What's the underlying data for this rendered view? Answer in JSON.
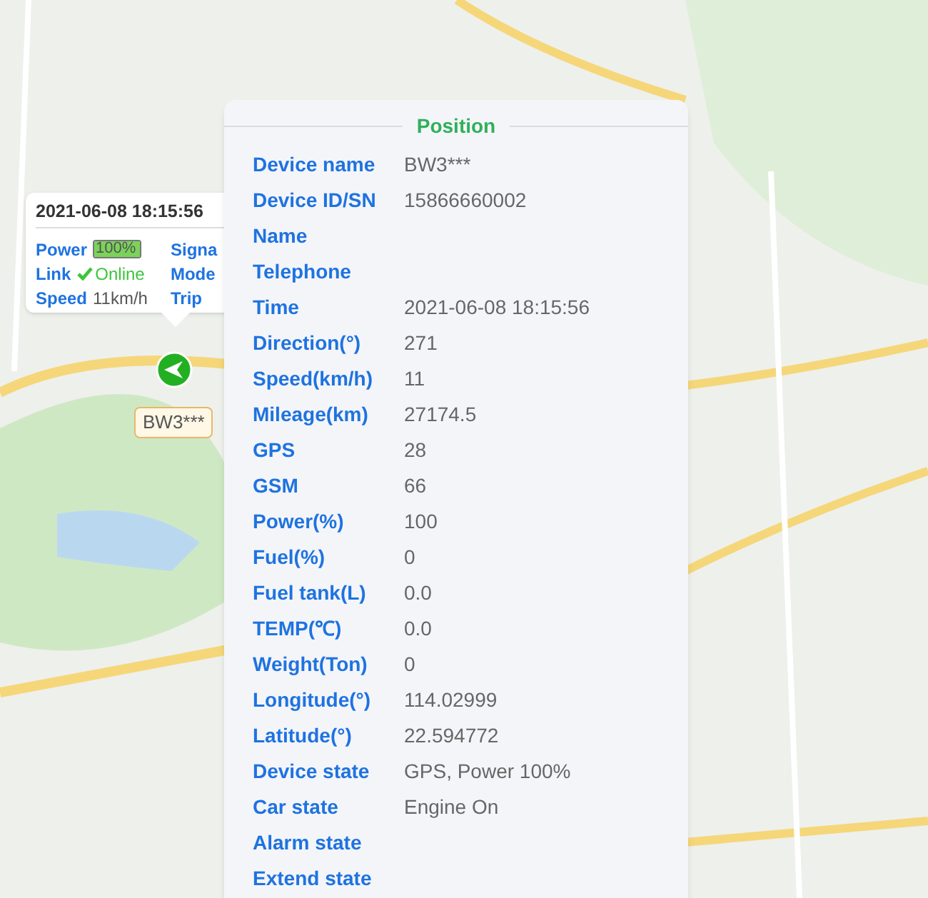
{
  "info_bubble": {
    "time": "2021-06-08 18:15:56",
    "fields": [
      {
        "kind": "battery",
        "label": "Power",
        "value": "100%",
        "level": 1
      },
      {
        "kind": "status",
        "label": "Link",
        "value": "Online"
      },
      {
        "kind": "text",
        "label": "Speed",
        "value": "11km/h"
      }
    ],
    "cut_labels": [
      "Signa",
      "Mode",
      "Trip"
    ]
  },
  "marker": {
    "label": "BW3***"
  },
  "position_panel": {
    "title": "Position",
    "rows": [
      {
        "label": "Device name",
        "value": "BW3***"
      },
      {
        "label": "Device ID/SN",
        "value": "15866660002"
      },
      {
        "label": "Name"
      },
      {
        "label": "Telephone"
      },
      {
        "label": "Time",
        "value": "2021-06-08 18:15:56"
      },
      {
        "label": "Direction(°)",
        "value": "271"
      },
      {
        "label": "Speed(km/h)",
        "value": "11"
      },
      {
        "label": "Mileage(km)",
        "value": "27174.5"
      },
      {
        "label": "GPS",
        "value": "28"
      },
      {
        "label": "GSM",
        "value": "66"
      },
      {
        "label": "Power(%)",
        "value": "100"
      },
      {
        "label": "Fuel(%)",
        "value": "0"
      },
      {
        "label": "Fuel tank(L)",
        "value": "0.0"
      },
      {
        "label": "TEMP(℃)",
        "value": "0.0"
      },
      {
        "label": "Weight(Ton)",
        "value": "0"
      },
      {
        "label": "Longitude(°)",
        "value": "114.02999"
      },
      {
        "label": "Latitude(°)",
        "value": "22.594772"
      },
      {
        "label": "Device state",
        "value": "GPS, Power 100%"
      },
      {
        "label": "Car state",
        "value": "Engine On"
      },
      {
        "label": "Alarm state"
      },
      {
        "label": "Extend state"
      }
    ]
  }
}
